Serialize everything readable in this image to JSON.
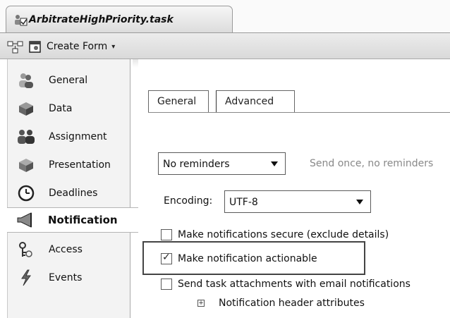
{
  "window": {
    "tab_title": "ArbitrateHighPriority.task"
  },
  "toolbar": {
    "create_form_label": "Create Form",
    "caret": "▾"
  },
  "sidebar": {
    "items": [
      {
        "label": "General",
        "icon": "people-icon"
      },
      {
        "label": "Data",
        "icon": "data-box-icon"
      },
      {
        "label": "Assignment",
        "icon": "assignment-icon"
      },
      {
        "label": "Presentation",
        "icon": "presentation-icon"
      },
      {
        "label": "Deadlines",
        "icon": "clock-icon"
      },
      {
        "label": "Notification",
        "icon": "megaphone-icon",
        "selected": true
      },
      {
        "label": "Access",
        "icon": "key-icon"
      },
      {
        "label": "Events",
        "icon": "lightning-icon"
      }
    ]
  },
  "main": {
    "tabs": [
      {
        "label": "General"
      },
      {
        "label": "Advanced",
        "active": true
      }
    ],
    "reminders": {
      "value": "No reminders",
      "hint": "Send once, no reminders"
    },
    "encoding": {
      "label": "Encoding:",
      "value": "UTF-8"
    },
    "checkboxes": [
      {
        "label": "Make notifications secure (exclude details)",
        "checked": false
      },
      {
        "label": "Make notification actionable",
        "checked": true
      },
      {
        "label": "Send task attachments with email notifications",
        "checked": false
      }
    ],
    "checkmark": "✓",
    "expander": {
      "symbol": "+",
      "label": "Notification header attributes"
    }
  }
}
